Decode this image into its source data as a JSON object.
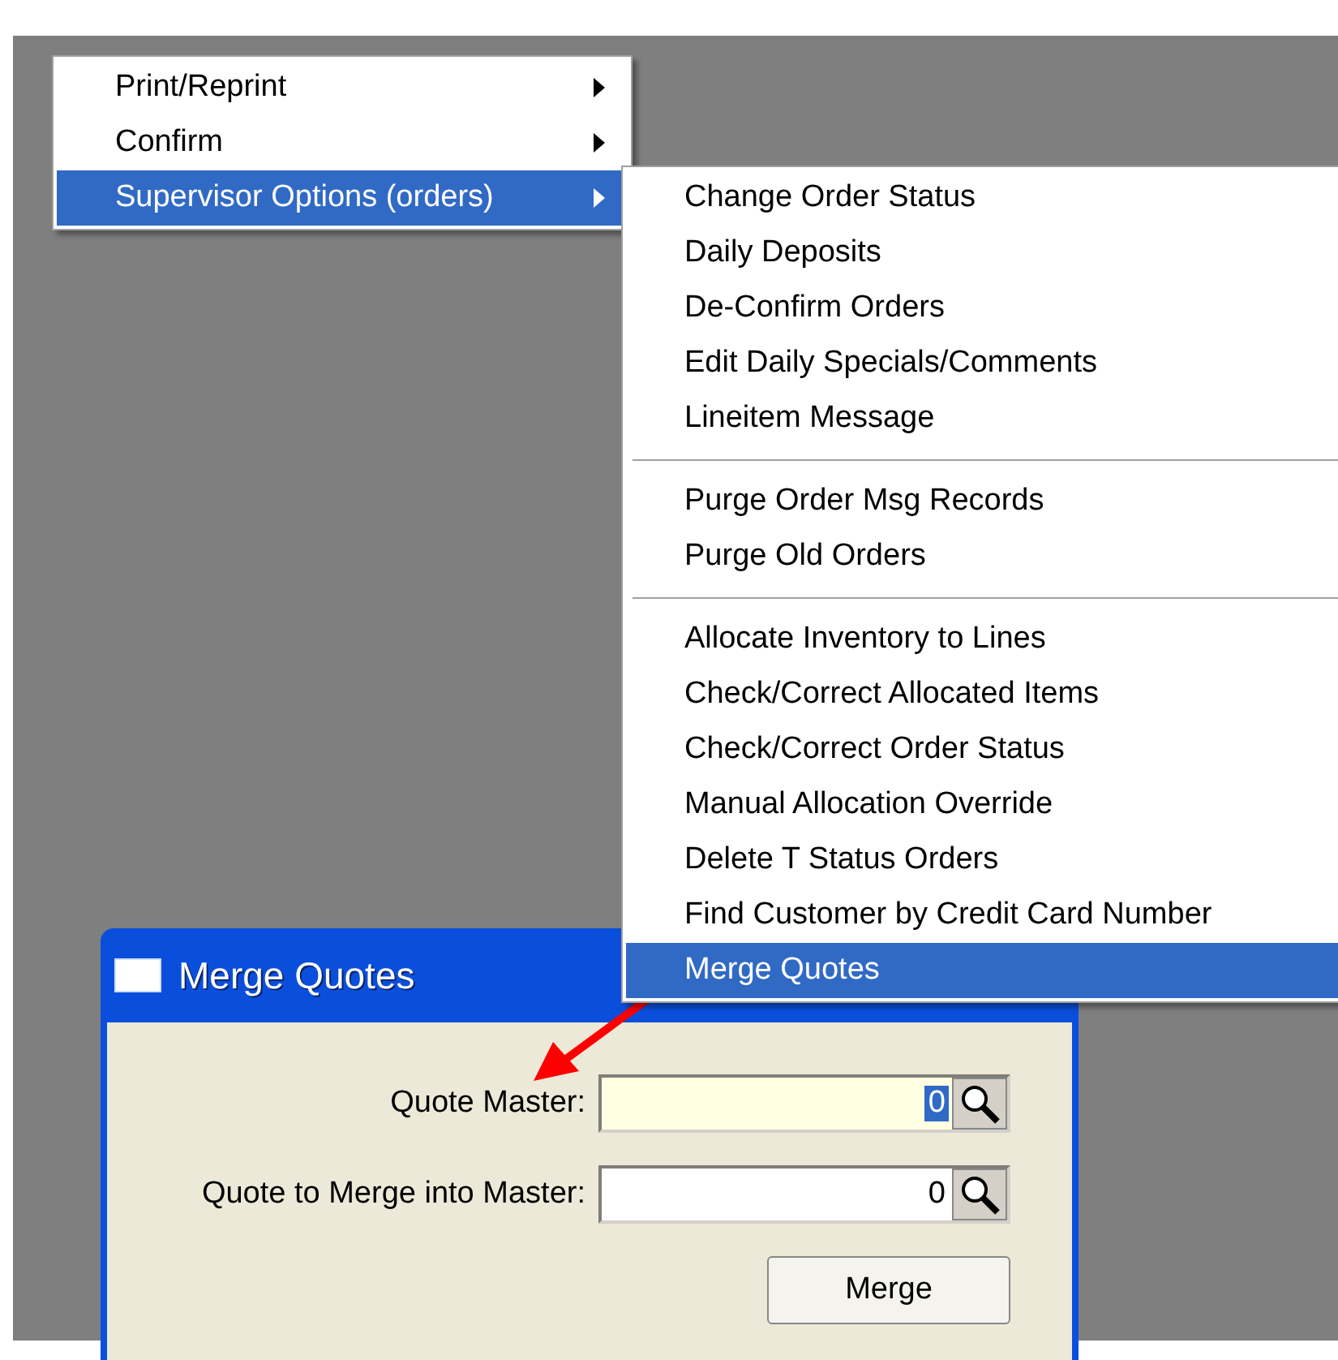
{
  "menu": {
    "items": [
      {
        "label": "Print/Reprint",
        "has_submenu": true,
        "selected": false
      },
      {
        "label": "Confirm",
        "has_submenu": true,
        "selected": false
      },
      {
        "label": "Supervisor Options (orders)",
        "has_submenu": true,
        "selected": true
      }
    ]
  },
  "submenu": {
    "groups": [
      [
        {
          "label": "Change Order Status",
          "selected": false
        },
        {
          "label": "Daily Deposits",
          "selected": false
        },
        {
          "label": "De-Confirm Orders",
          "selected": false
        },
        {
          "label": "Edit Daily Specials/Comments",
          "selected": false
        },
        {
          "label": "Lineitem Message",
          "selected": false
        }
      ],
      [
        {
          "label": "Purge Order Msg Records",
          "selected": false
        },
        {
          "label": "Purge Old Orders",
          "selected": false
        }
      ],
      [
        {
          "label": "Allocate Inventory to Lines",
          "selected": false
        },
        {
          "label": "Check/Correct Allocated Items",
          "selected": false
        },
        {
          "label": "Check/Correct Order Status",
          "selected": false
        },
        {
          "label": "Manual Allocation Override",
          "selected": false
        },
        {
          "label": "Delete T Status Orders",
          "selected": false
        },
        {
          "label": "Find Customer by Credit Card Number",
          "selected": false
        },
        {
          "label": "Merge Quotes",
          "selected": true
        }
      ]
    ]
  },
  "dialog": {
    "title": "Merge Quotes",
    "fields": [
      {
        "label": "Quote Master:",
        "value": "0",
        "focused": true
      },
      {
        "label": "Quote to Merge into Master:",
        "value": "0",
        "focused": false
      }
    ],
    "button": "Merge"
  }
}
